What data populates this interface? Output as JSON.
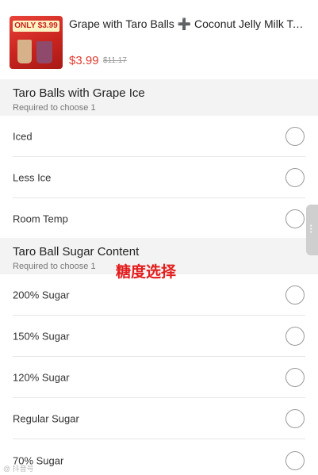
{
  "product": {
    "name": "Grape with Taro Balls ➕ Coconut Jelly Milk Te...",
    "price": "$3.99",
    "original_price": "$11.17",
    "thumb_promo": "ONLY $3.99"
  },
  "sections": [
    {
      "title": "Taro Balls with Grape Ice",
      "subtitle": "Required to choose 1",
      "options": [
        "Iced",
        "Less Ice",
        "Room Temp"
      ]
    },
    {
      "title": "Taro Ball Sugar Content",
      "subtitle": "Required to choose 1",
      "options": [
        "200% Sugar",
        "150% Sugar",
        "120% Sugar",
        "Regular Sugar",
        "70% Sugar"
      ]
    }
  ],
  "overlay_caption": "糖度选择",
  "watermark": "@ 抖音号"
}
